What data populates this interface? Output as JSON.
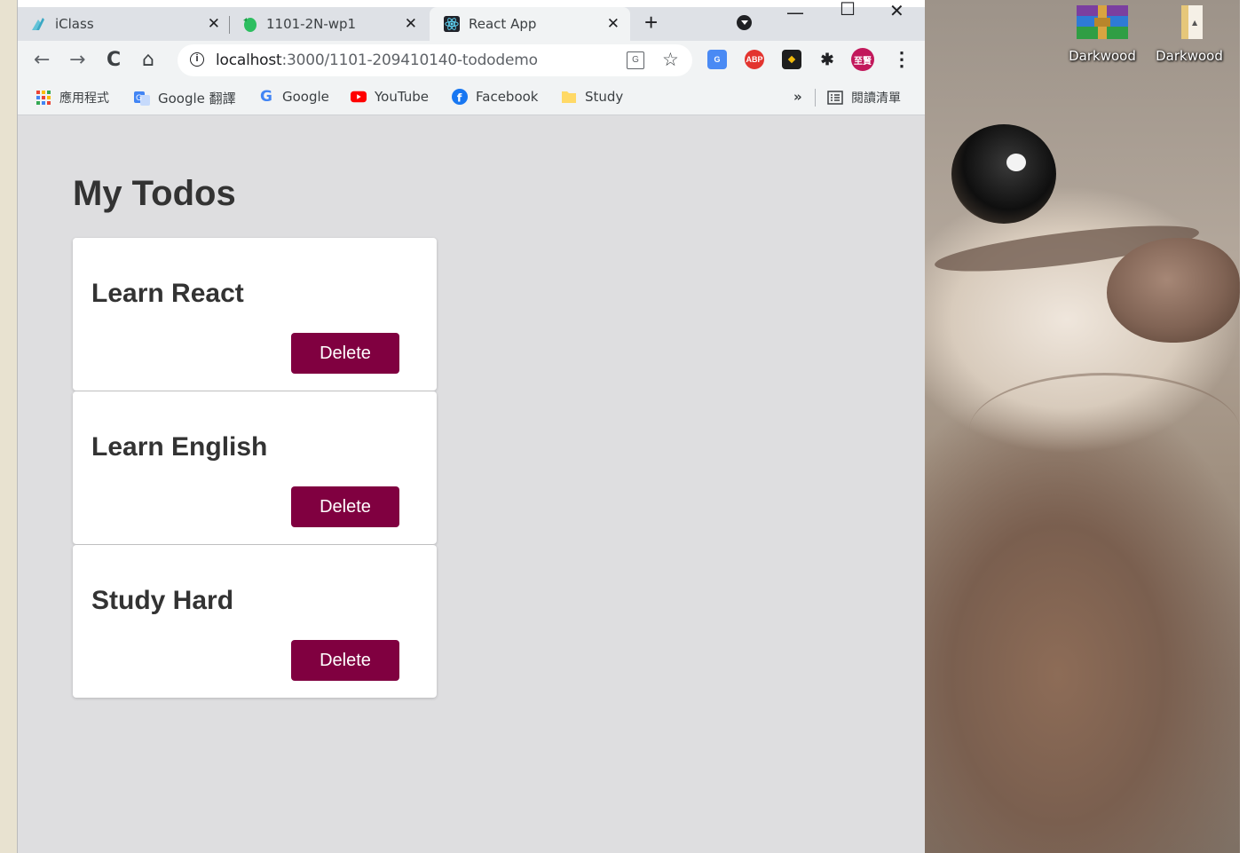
{
  "browser": {
    "tabs": [
      {
        "title": "iClass",
        "icon": "iclass-icon",
        "active": false
      },
      {
        "title": "1101-2N-wp1",
        "icon": "evernote-icon",
        "active": false
      },
      {
        "title": "React App",
        "icon": "react-icon",
        "active": true
      }
    ],
    "new_tab_label": "+",
    "address": {
      "host": "localhost",
      "rest": ":3000/1101-209410140-tododemo"
    },
    "profile_badge": "至賢",
    "extensions": [
      "google-translate-icon",
      "adblock-plus-icon",
      "binance-icon",
      "puzzle-icon",
      "profile-icon"
    ],
    "abp_label": "ABP",
    "bookmarks": [
      {
        "label": "應用程式",
        "icon": "apps-grid-icon"
      },
      {
        "label": "Google 翻譯",
        "icon": "google-translate-icon"
      },
      {
        "label": "Google",
        "icon": "google-icon"
      },
      {
        "label": "YouTube",
        "icon": "youtube-icon"
      },
      {
        "label": "Facebook",
        "icon": "facebook-icon"
      },
      {
        "label": "Study",
        "icon": "folder-icon"
      }
    ],
    "bookmarks_overflow": "»",
    "reading_list_label": "閱讀清單"
  },
  "app": {
    "title": "My Todos",
    "todos": [
      {
        "text": "Learn React",
        "action": "Delete"
      },
      {
        "text": "Learn English",
        "action": "Delete"
      },
      {
        "text": "Study Hard",
        "action": "Delete"
      }
    ],
    "button_color": "#800040"
  },
  "desktop": {
    "icons": [
      {
        "label": "Darkwood",
        "icon": "winrar-archive-icon"
      },
      {
        "label": "Darkwood",
        "icon": "folder-icon"
      }
    ]
  }
}
